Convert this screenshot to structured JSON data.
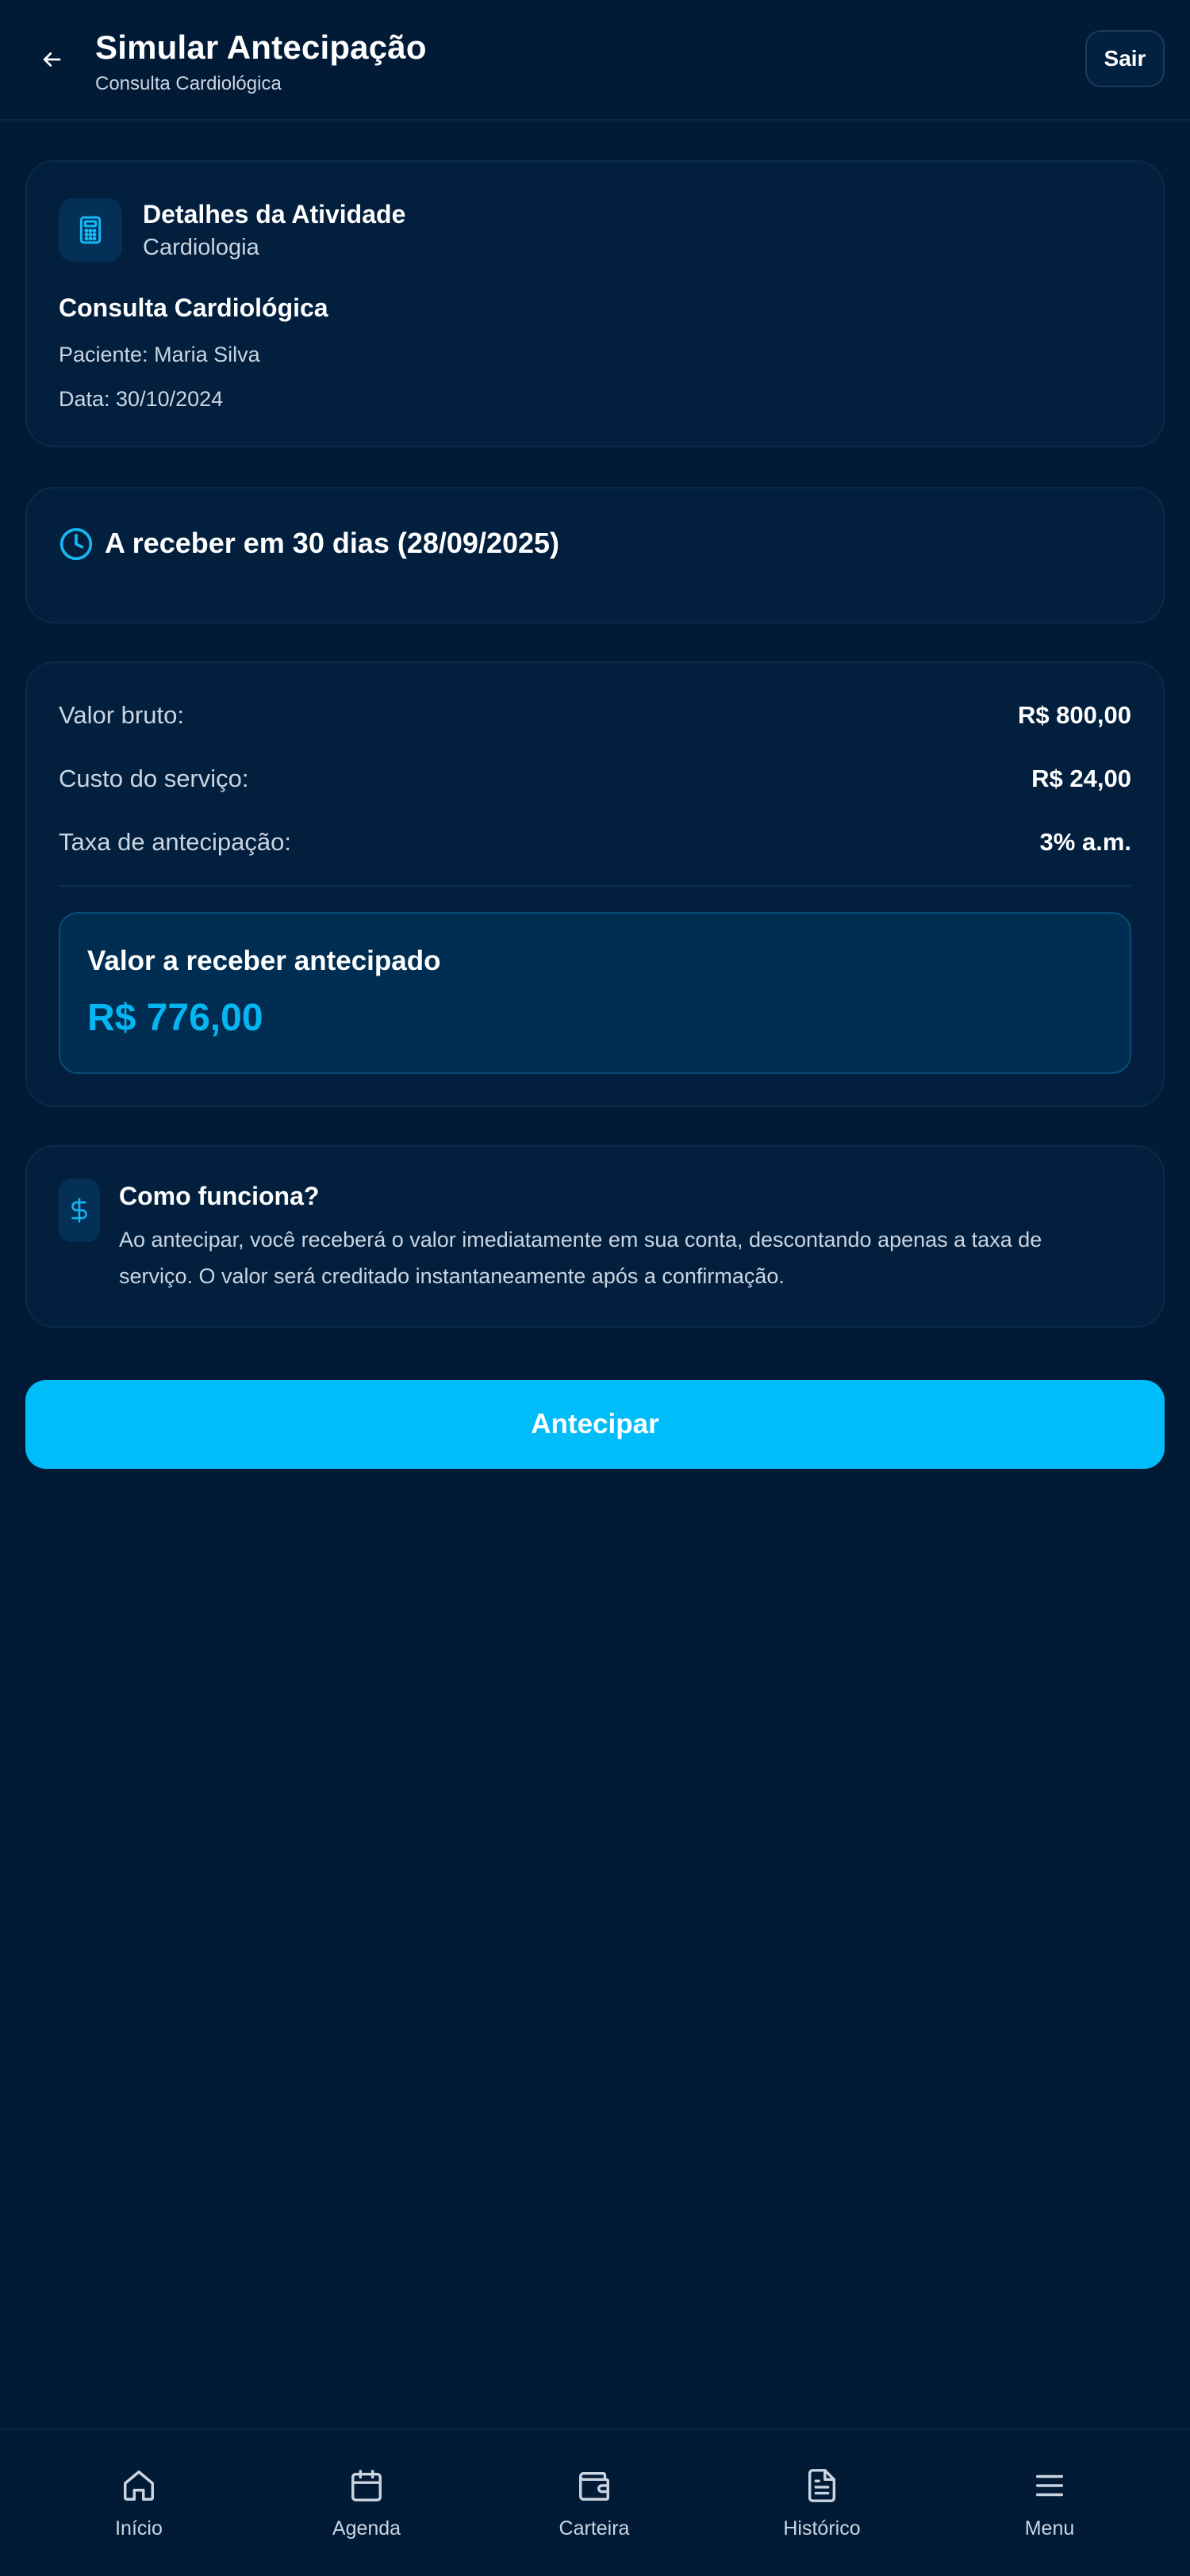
{
  "header": {
    "title": "Simular Antecipação",
    "subtitle": "Consulta Cardiológica",
    "exit_label": "Sair"
  },
  "details": {
    "title": "Detalhes da Atividade",
    "subtitle": "Cardiologia",
    "activity_name": "Consulta Cardiológica",
    "patient": "Paciente: Maria Silva",
    "date": "Data: 30/10/2024"
  },
  "due": {
    "text": "A receber em 30 dias (28/09/2025)"
  },
  "values": {
    "rows": [
      {
        "label": "Valor bruto:",
        "value": "R$ 800,00"
      },
      {
        "label": "Custo do serviço:",
        "value": "R$ 24,00"
      },
      {
        "label": "Taxa de antecipação:",
        "value": "3% a.m."
      }
    ],
    "highlight_label": "Valor a receber antecipado",
    "highlight_value": "R$ 776,00"
  },
  "info": {
    "title": "Como funciona?",
    "text": "Ao antecipar, você receberá o valor imediatamente em sua conta, descontando apenas a taxa de serviço. O valor será creditado instantaneamente após a confirmação."
  },
  "cta_label": "Antecipar",
  "nav": [
    {
      "label": "Início",
      "icon": "home-icon"
    },
    {
      "label": "Agenda",
      "icon": "calendar-icon"
    },
    {
      "label": "Carteira",
      "icon": "wallet-icon"
    },
    {
      "label": "Histórico",
      "icon": "document-icon"
    },
    {
      "label": "Menu",
      "icon": "menu-icon"
    }
  ],
  "colors": {
    "background": "#011a36",
    "card": "#021f3e",
    "accent": "#00bdf9",
    "highlight_value": "#06b6f2"
  }
}
